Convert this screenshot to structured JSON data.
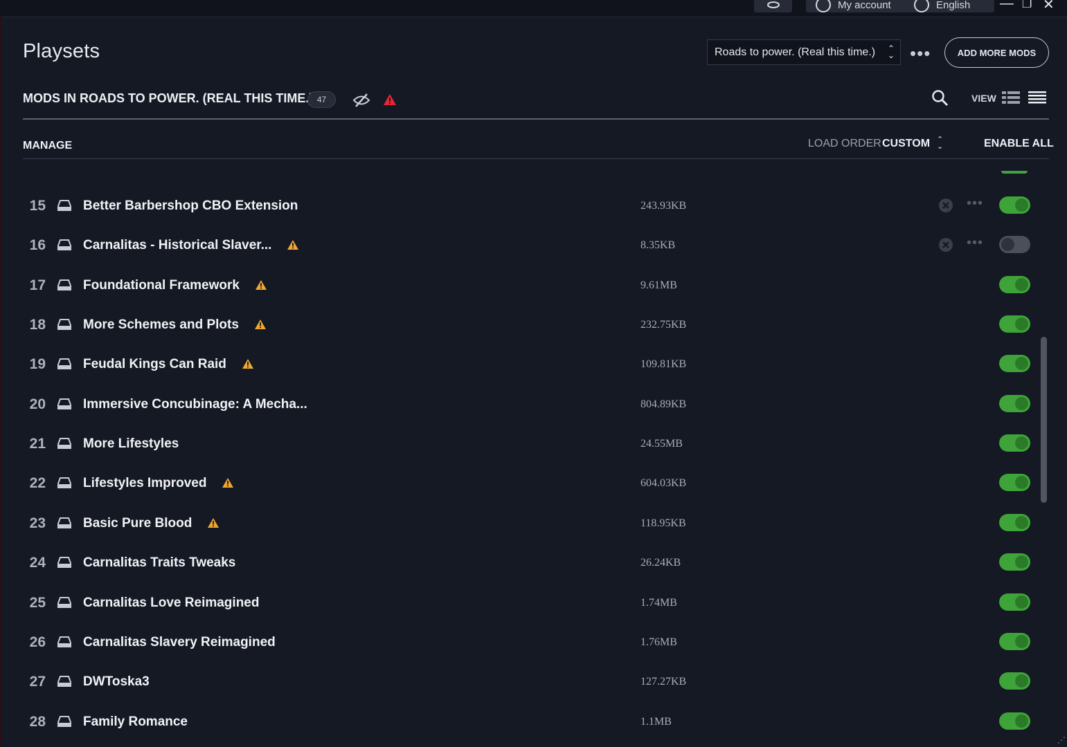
{
  "topbar": {
    "account_label": "My account",
    "language_label": "English",
    "icons": [
      "coins-icon",
      "account-icon",
      "globe-icon",
      "minimize-icon",
      "restore-icon",
      "close-icon"
    ]
  },
  "header": {
    "title": "Playsets",
    "playset_select_value": "Roads to power. (Real this time.)",
    "add_more_mods_label": "ADD MORE MODS"
  },
  "subheader": {
    "mods_title": "MODS IN ROADS TO POWER. (REAL THIS TIME.)",
    "mod_count": "47",
    "view_label": "VIEW"
  },
  "toolbar": {
    "manage_label": "MANAGE",
    "load_order_label": "LOAD ORDER",
    "load_order_value": "CUSTOM",
    "enable_all_label": "ENABLE ALL"
  },
  "colors": {
    "background": "#151924",
    "toggle_on": "#3ea43a",
    "warning": "#f0a630",
    "error": "#e8263a"
  },
  "mods": [
    {
      "num": "15",
      "name": "Better Barbershop CBO Extension",
      "size": "243.93KB",
      "warning": false,
      "enabled": true,
      "actions": true
    },
    {
      "num": "16",
      "name": "Carnalitas - Historical Slaver...",
      "size": "8.35KB",
      "warning": true,
      "enabled": false,
      "actions": true
    },
    {
      "num": "17",
      "name": "Foundational Framework",
      "size": "9.61MB",
      "warning": true,
      "enabled": true,
      "actions": false
    },
    {
      "num": "18",
      "name": "More Schemes and Plots",
      "size": "232.75KB",
      "warning": true,
      "enabled": true,
      "actions": false
    },
    {
      "num": "19",
      "name": "Feudal Kings Can Raid",
      "size": "109.81KB",
      "warning": true,
      "enabled": true,
      "actions": false
    },
    {
      "num": "20",
      "name": "Immersive Concubinage: A Mecha...",
      "size": "804.89KB",
      "warning": false,
      "enabled": true,
      "actions": false
    },
    {
      "num": "21",
      "name": "More Lifestyles",
      "size": "24.55MB",
      "warning": false,
      "enabled": true,
      "actions": false
    },
    {
      "num": "22",
      "name": "Lifestyles Improved",
      "size": "604.03KB",
      "warning": true,
      "enabled": true,
      "actions": false
    },
    {
      "num": "23",
      "name": "Basic Pure Blood",
      "size": "118.95KB",
      "warning": true,
      "enabled": true,
      "actions": false
    },
    {
      "num": "24",
      "name": "Carnalitas Traits Tweaks",
      "size": "26.24KB",
      "warning": false,
      "enabled": true,
      "actions": false
    },
    {
      "num": "25",
      "name": "Carnalitas Love Reimagined",
      "size": "1.74MB",
      "warning": false,
      "enabled": true,
      "actions": false
    },
    {
      "num": "26",
      "name": "Carnalitas Slavery Reimagined",
      "size": "1.76MB",
      "warning": false,
      "enabled": true,
      "actions": false
    },
    {
      "num": "27",
      "name": "DWToska3",
      "size": "127.27KB",
      "warning": false,
      "enabled": true,
      "actions": false
    },
    {
      "num": "28",
      "name": "Family Romance",
      "size": "1.1MB",
      "warning": false,
      "enabled": true,
      "actions": false
    }
  ]
}
